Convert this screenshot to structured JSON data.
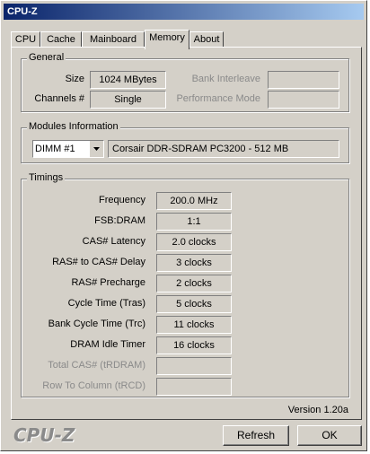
{
  "window": {
    "title": "CPU-Z"
  },
  "tabs": [
    "CPU",
    "Cache",
    "Mainboard",
    "Memory",
    "About"
  ],
  "active_tab": "Memory",
  "general": {
    "title": "General",
    "size_label": "Size",
    "size_value": "1024 MBytes",
    "channels_label": "Channels #",
    "channels_value": "Single",
    "bank_interleave_label": "Bank Interleave",
    "bank_interleave_value": "",
    "performance_mode_label": "Performance Mode",
    "performance_mode_value": ""
  },
  "modules": {
    "title": "Modules Information",
    "slot_selected": "DIMM #1",
    "module_desc": "Corsair DDR-SDRAM PC3200 - 512 MB"
  },
  "timings": {
    "title": "Timings",
    "rows": [
      {
        "label": "Frequency",
        "value": "200.0 MHz",
        "disabled": false
      },
      {
        "label": "FSB:DRAM",
        "value": "1:1",
        "disabled": false
      },
      {
        "label": "CAS# Latency",
        "value": "2.0 clocks",
        "disabled": false
      },
      {
        "label": "RAS# to CAS# Delay",
        "value": "3 clocks",
        "disabled": false
      },
      {
        "label": "RAS# Precharge",
        "value": "2 clocks",
        "disabled": false
      },
      {
        "label": "Cycle Time (Tras)",
        "value": "5 clocks",
        "disabled": false
      },
      {
        "label": "Bank Cycle Time (Trc)",
        "value": "11 clocks",
        "disabled": false
      },
      {
        "label": "DRAM Idle Timer",
        "value": "16 clocks",
        "disabled": false
      },
      {
        "label": "Total CAS# (tRDRAM)",
        "value": "",
        "disabled": true
      },
      {
        "label": "Row To Column (tRCD)",
        "value": "",
        "disabled": true
      }
    ]
  },
  "footer": {
    "version": "Version 1.20a",
    "brand": "CPU-Z",
    "refresh_label": "Refresh",
    "ok_label": "OK"
  }
}
